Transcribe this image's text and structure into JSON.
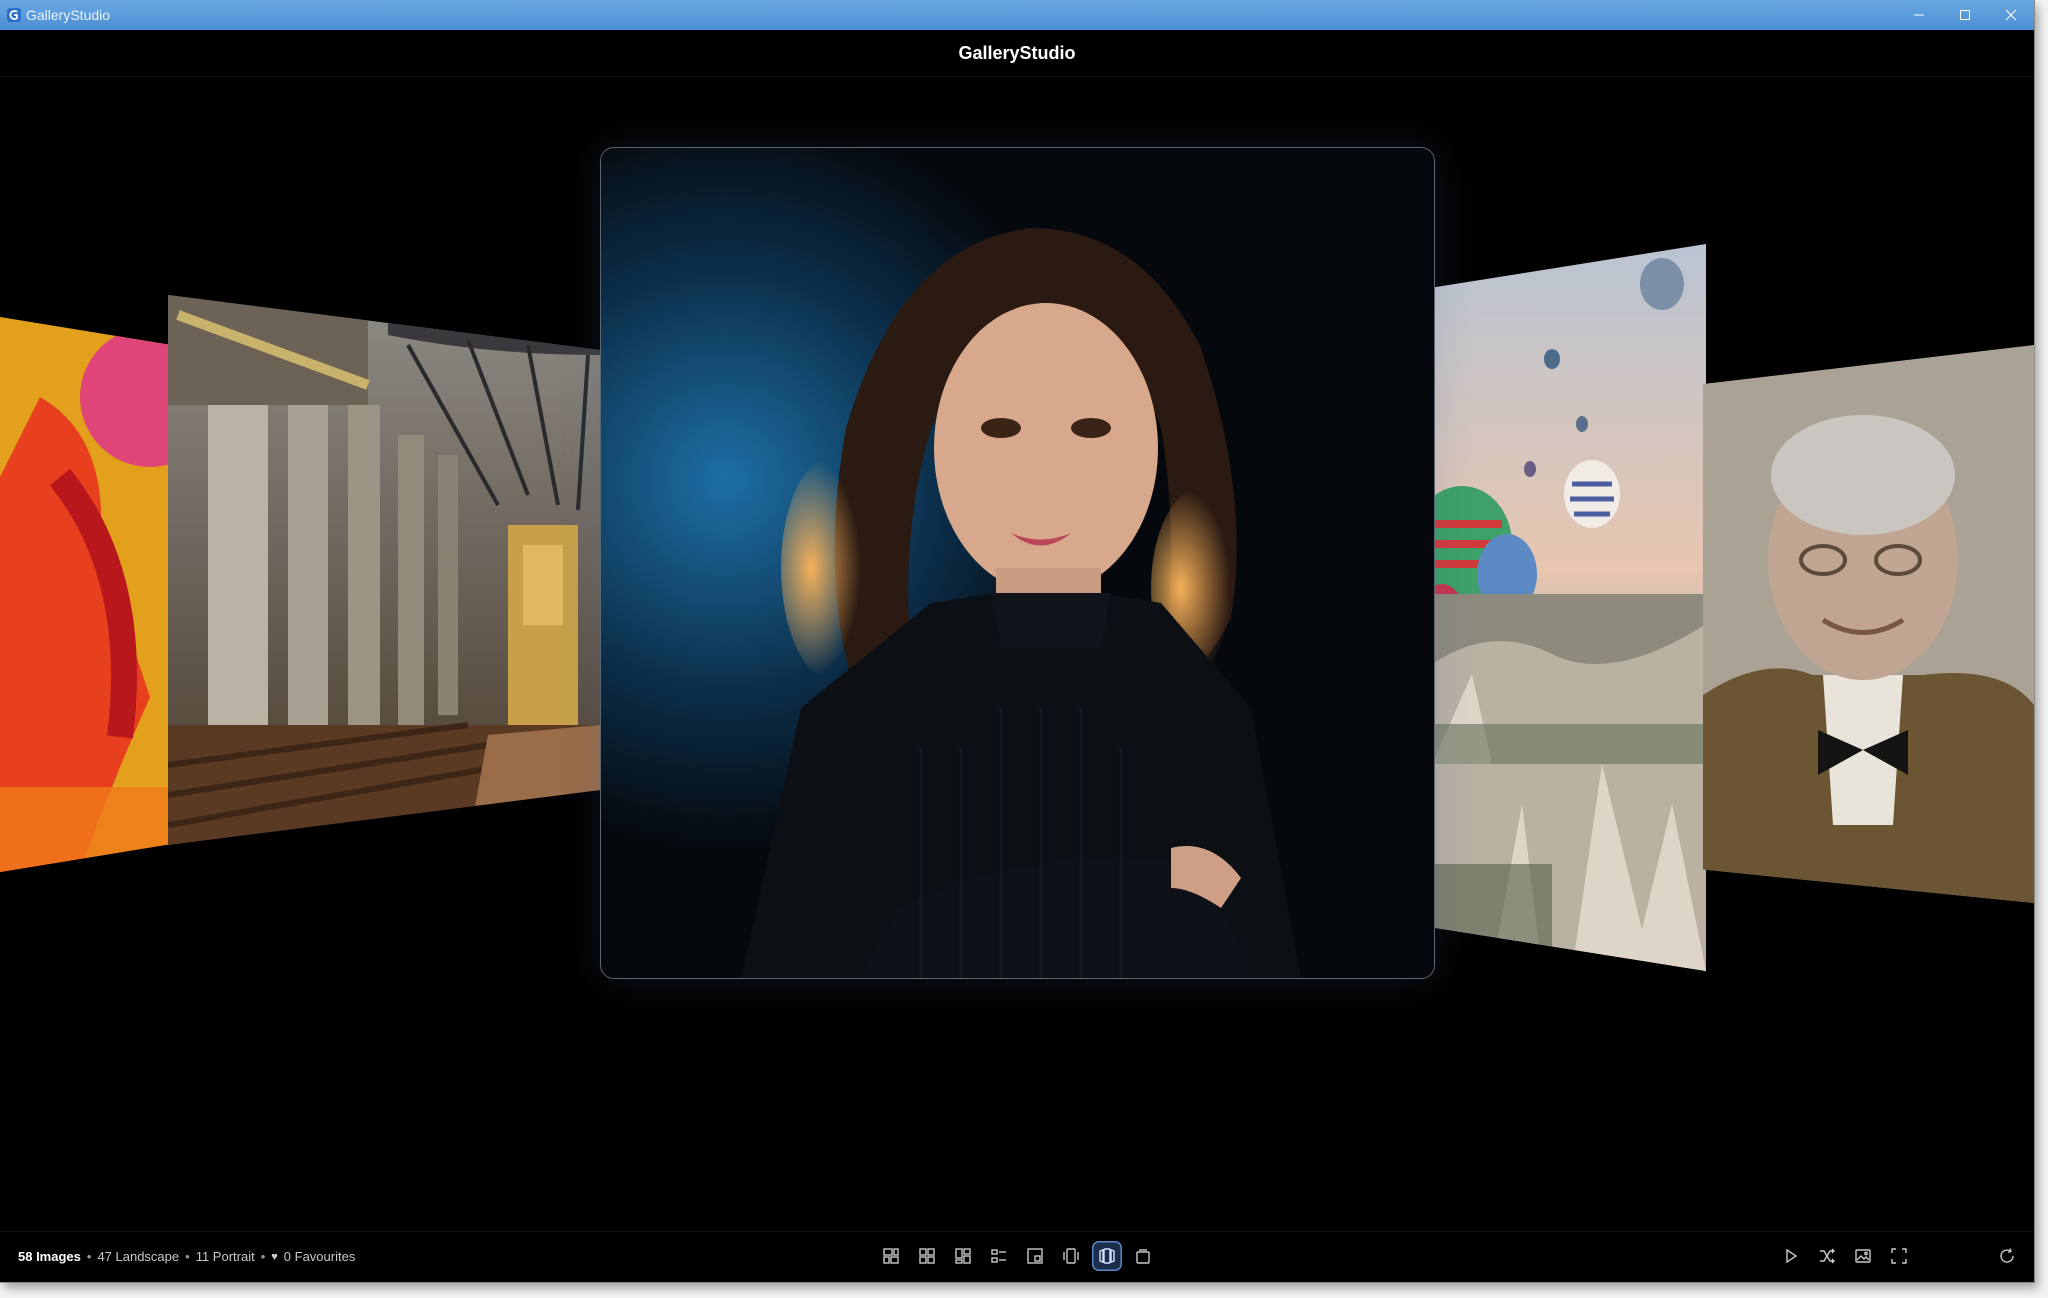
{
  "window": {
    "title": "GalleryStudio",
    "accent_color": "#4b8ed3",
    "controls": [
      "minimize-icon",
      "maximize-icon",
      "close-icon"
    ]
  },
  "app": {
    "title": "GalleryStudio"
  },
  "carousel": {
    "layout": "coverflow",
    "cards": [
      {
        "position": "far-left",
        "subject": "colorful fashion figure",
        "icon": "image-thumbnail"
      },
      {
        "position": "left",
        "subject": "gothic cathedral interior",
        "icon": "image-thumbnail"
      },
      {
        "position": "center",
        "subject": "woman in black turtleneck portrait",
        "icon": "image-thumbnail",
        "selected": true
      },
      {
        "position": "right",
        "subject": "hot air balloons over valley",
        "icon": "image-thumbnail"
      },
      {
        "position": "far-right",
        "subject": "elderly man with bow tie portrait",
        "icon": "image-thumbnail"
      }
    ]
  },
  "status": {
    "images": "58 Images",
    "sep": "•",
    "landscape": "47 Landscape",
    "portrait": "11 Portrait",
    "favourites": "0 Favourites",
    "heart_icon": "♥"
  },
  "view_modes": [
    {
      "icon": "mosaic-view-icon"
    },
    {
      "icon": "grid-view-icon"
    },
    {
      "icon": "masonry-view-icon"
    },
    {
      "icon": "list-view-icon"
    },
    {
      "icon": "single-view-icon"
    },
    {
      "icon": "carousel-view-icon"
    },
    {
      "icon": "coverflow-view-icon",
      "active": true
    },
    {
      "icon": "stack-view-icon"
    }
  ],
  "tools": [
    {
      "icon": "play-slideshow-icon"
    },
    {
      "icon": "shuffle-icon"
    },
    {
      "icon": "image-icon"
    },
    {
      "icon": "fullscreen-icon"
    },
    {
      "icon": "refresh-icon"
    }
  ],
  "colors": {
    "background": "#000000",
    "active_button": "#1c2e4b",
    "active_border": "#5a88c8"
  }
}
